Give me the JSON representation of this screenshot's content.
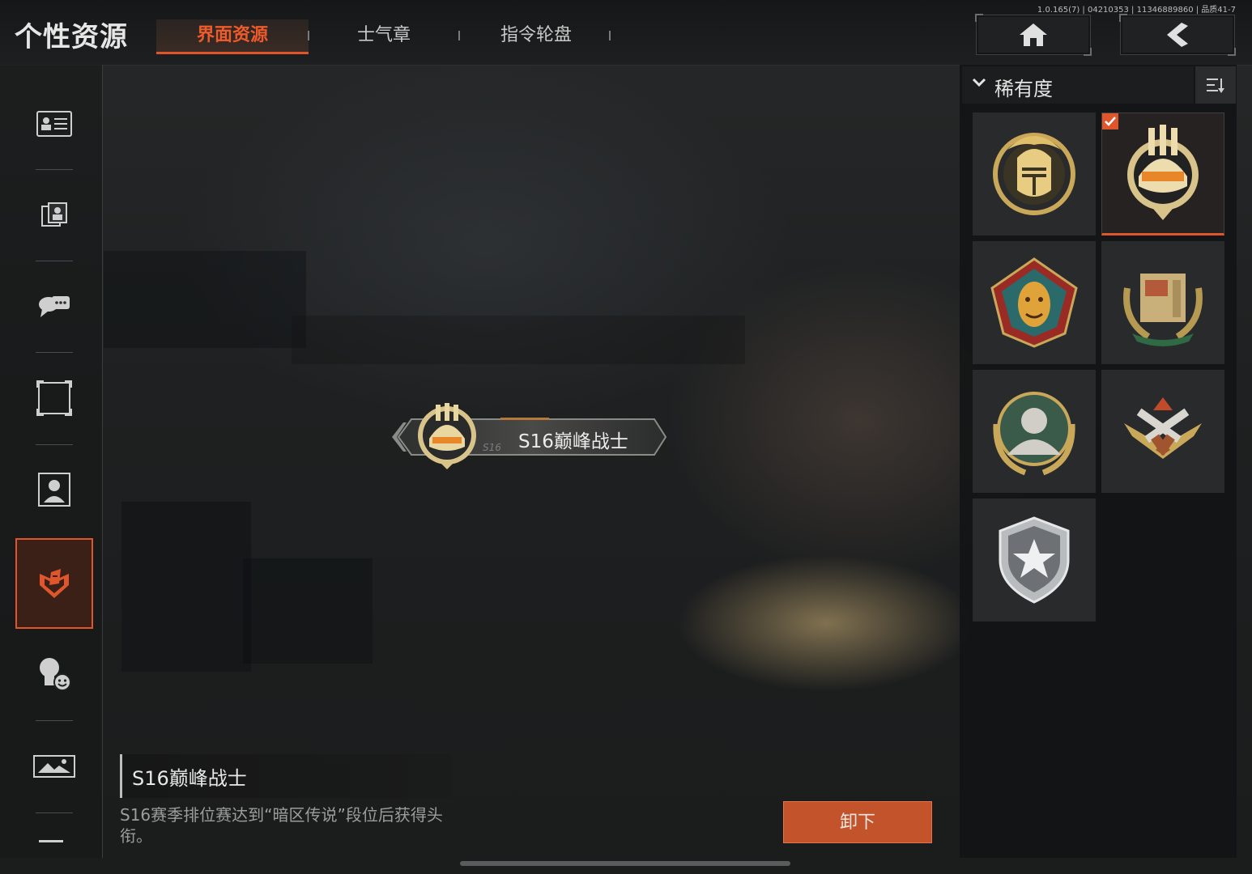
{
  "header": {
    "page_title": "个性资源",
    "tabs": [
      {
        "label": "界面资源",
        "active": true
      },
      {
        "label": "士气章",
        "active": false
      },
      {
        "label": "指令轮盘",
        "active": false
      }
    ],
    "version_text": "1.0.165(7) | 04210353 | 11346889860 | 品质41-7",
    "home_icon": "home-icon",
    "back_icon": "back-arrow-icon"
  },
  "left_nav": {
    "items": [
      {
        "icon": "id-card-icon",
        "active": false
      },
      {
        "icon": "photo-frames-icon",
        "active": false
      },
      {
        "icon": "chat-bubbles-icon",
        "active": false
      },
      {
        "icon": "frame-icon",
        "active": false
      },
      {
        "icon": "portrait-icon",
        "active": false
      },
      {
        "icon": "title-badge-icon",
        "active": true
      },
      {
        "icon": "emote-icon",
        "active": false
      },
      {
        "icon": "gallery-icon",
        "active": false
      }
    ],
    "accent": "#e0562c"
  },
  "preview": {
    "title_text": "S16巅峰战士",
    "season_tag": "S16"
  },
  "description": {
    "title": "S16巅峰战士",
    "text": "S16赛季排位赛达到“暗区传说”段位后获得头衔。"
  },
  "action_button": {
    "label": "卸下"
  },
  "filter": {
    "label": "稀有度",
    "sort_icon": "sort-icon"
  },
  "badges": [
    {
      "icon": "gold-knight-helmet-badge",
      "selected": false
    },
    {
      "icon": "peak-warrior-helmet-badge",
      "selected": true
    },
    {
      "icon": "jester-mask-badge",
      "selected": false
    },
    {
      "icon": "supply-crate-laurel-badge",
      "selected": false
    },
    {
      "icon": "soldier-portrait-laurel-badge",
      "selected": false
    },
    {
      "icon": "crossed-pistols-badge",
      "selected": false
    },
    {
      "icon": "star-shield-badge",
      "selected": false
    }
  ]
}
